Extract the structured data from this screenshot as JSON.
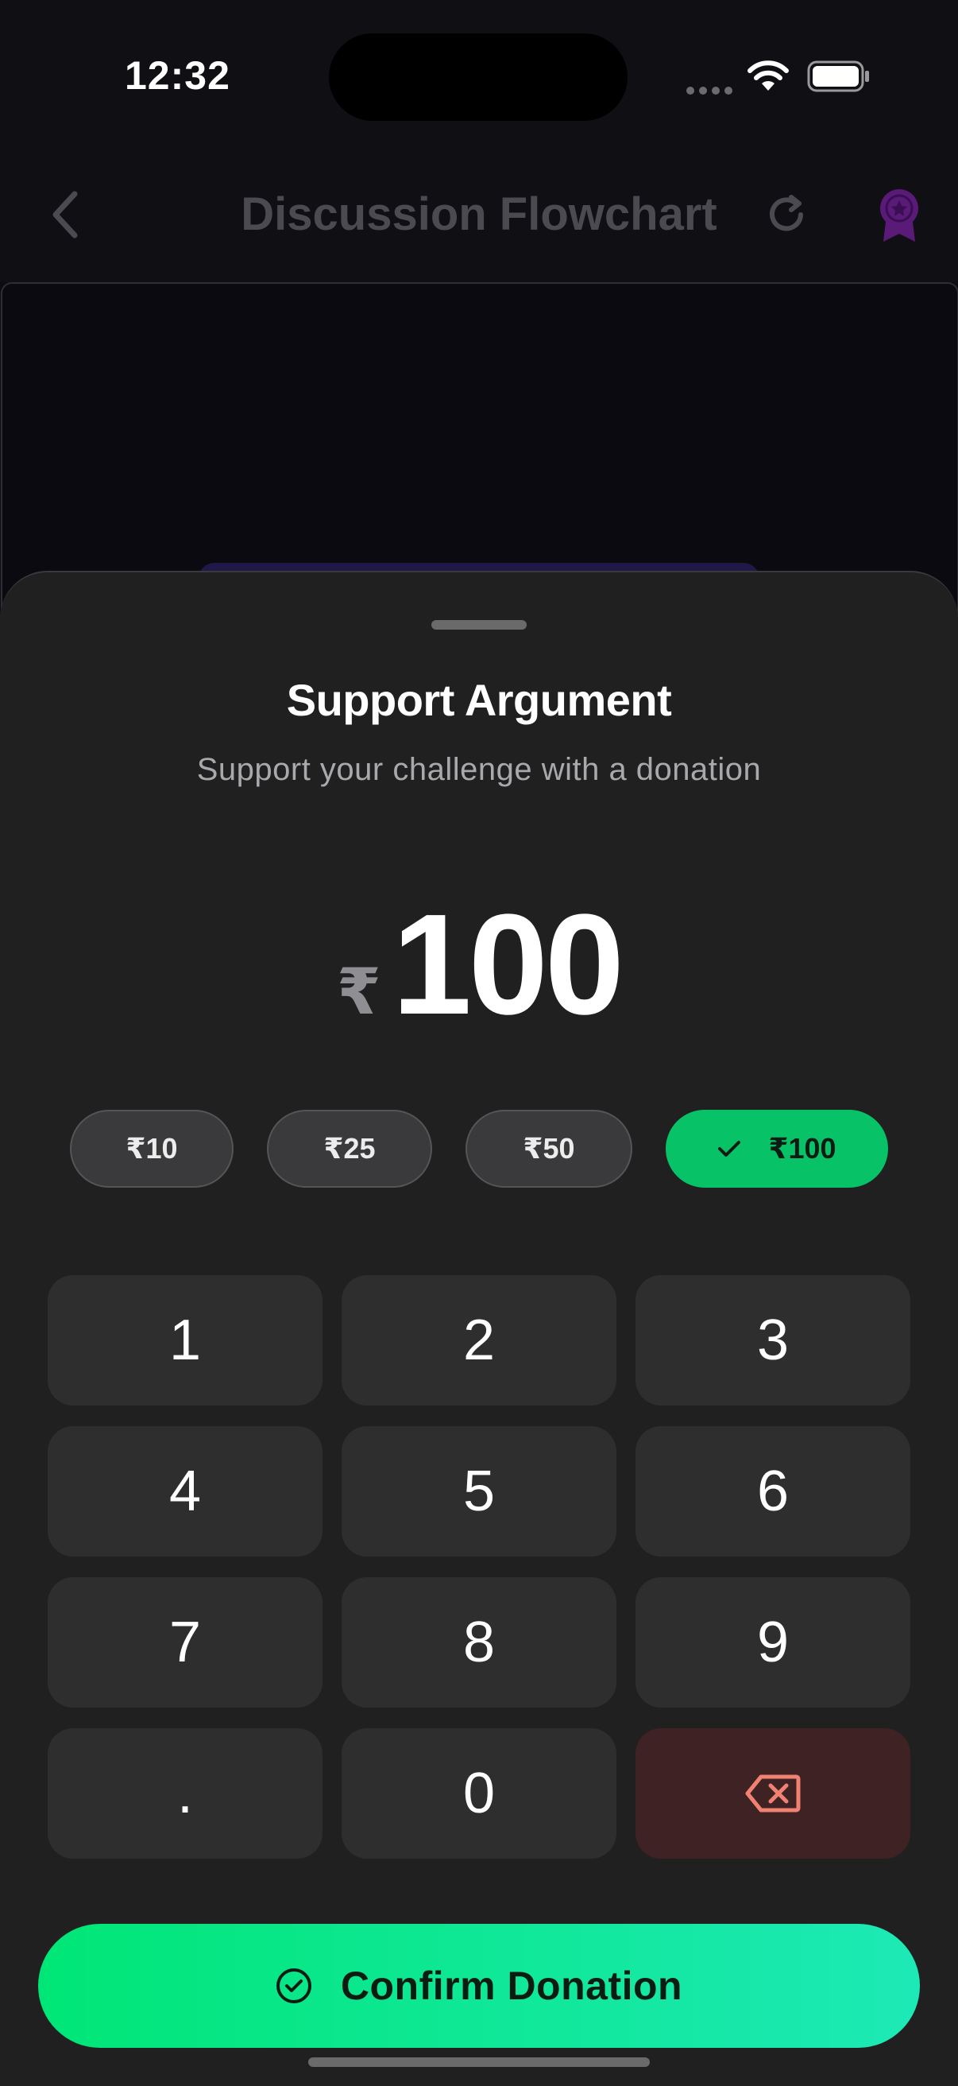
{
  "status_bar": {
    "time": "12:32"
  },
  "header": {
    "title": "Discussion Flowchart"
  },
  "sheet": {
    "title": "Support Argument",
    "subtitle": "Support your challenge with a donation",
    "currency_symbol": "₹",
    "amount": "100",
    "presets": [
      {
        "label": "₹10",
        "selected": false
      },
      {
        "label": "₹25",
        "selected": false
      },
      {
        "label": "₹50",
        "selected": false
      },
      {
        "label": "₹100",
        "selected": true
      }
    ],
    "keypad": [
      "1",
      "2",
      "3",
      "4",
      "5",
      "6",
      "7",
      "8",
      "9",
      ".",
      "0",
      "delete"
    ],
    "confirm_label": "Confirm Donation"
  },
  "colors": {
    "accent_green": "#08c268",
    "confirm_gradient_start": "#00e676",
    "confirm_gradient_end": "#1de9b6",
    "delete_key_bg": "#3f2224",
    "delete_icon": "#f08272",
    "award_icon": "#5a1a78"
  },
  "icons": {
    "back": "chevron-left-icon",
    "refresh": "refresh-icon",
    "award": "award-ribbon-icon",
    "check": "check-icon",
    "delete": "backspace-icon",
    "confirm": "check-circle-icon"
  }
}
